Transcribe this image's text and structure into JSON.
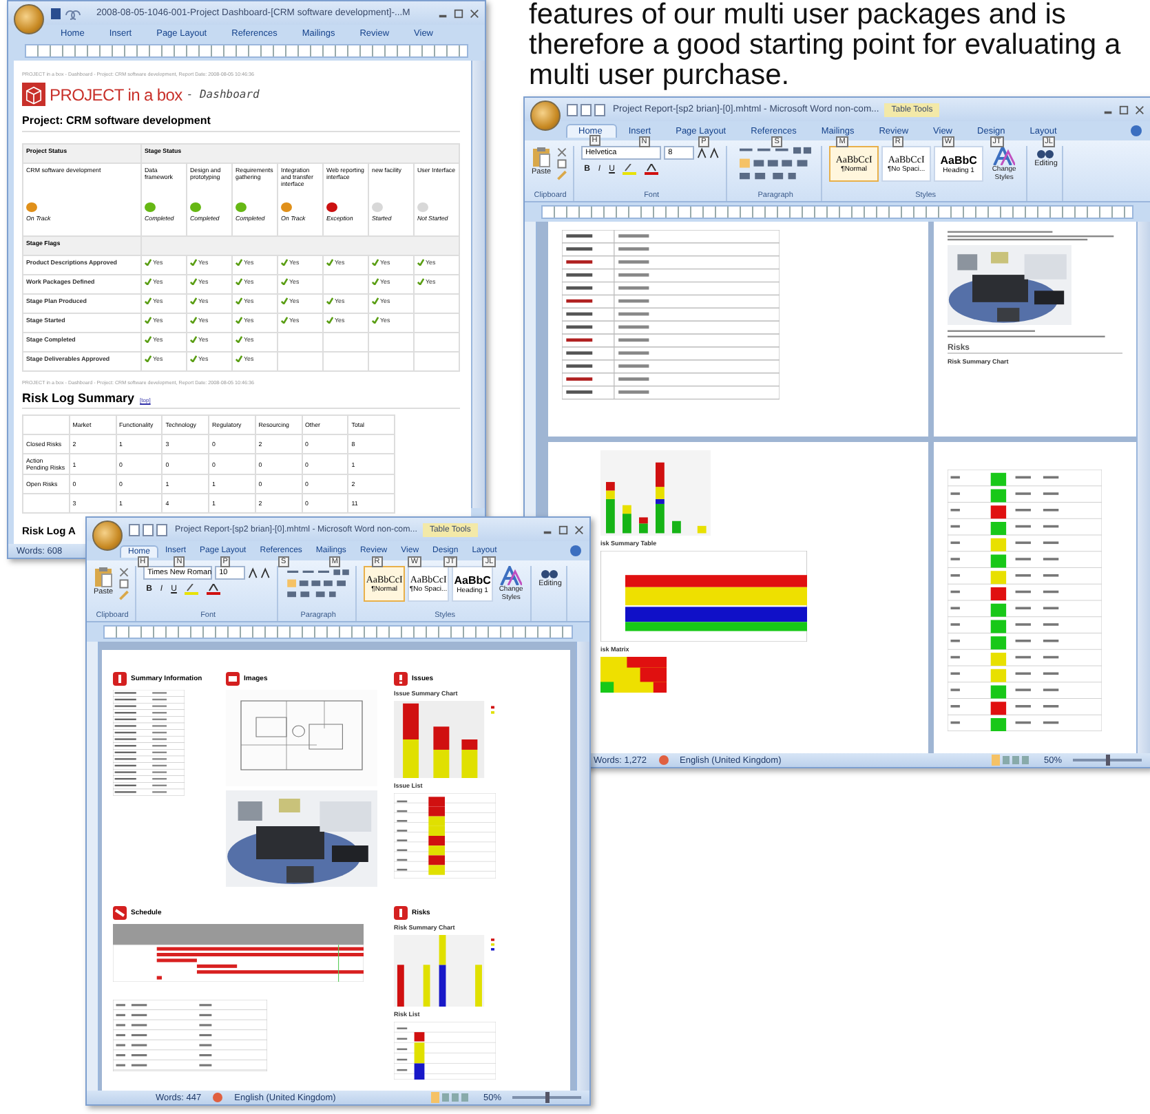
{
  "intro": {
    "text": "features of our multi user packages and is therefore a good starting point for evaluating a multi user purchase."
  },
  "dashboard_window": {
    "title": "2008-08-05-1046-001-Project Dashboard-[CRM software development]-...M",
    "tabs": [
      {
        "label": "Home",
        "selected": false
      },
      {
        "label": "Insert",
        "selected": false
      },
      {
        "label": "Page Layout",
        "selected": false
      },
      {
        "label": "References",
        "selected": false
      },
      {
        "label": "Mailings",
        "selected": false
      },
      {
        "label": "Review",
        "selected": false
      },
      {
        "label": "View",
        "selected": false
      }
    ],
    "breadcrumb": "PROJECT in a box - Dashboard - Project: CRM software development, Report Date: 2008-08-05 10:46:36",
    "logo_text": "PROJECT in a box",
    "logo_suffix": "- Dashboard",
    "project_heading": "Project: CRM software development",
    "status_table": {
      "project_header": "Project Status",
      "stage_header": "Stage Status",
      "project": {
        "name": "CRM software development",
        "status": "On Track",
        "color": "#e0901a"
      },
      "stages": [
        {
          "name": "Data framework",
          "status": "Completed",
          "color": "#66b814"
        },
        {
          "name": "Design and prototyping",
          "status": "Completed",
          "color": "#66b814"
        },
        {
          "name": "Requirements gathering",
          "status": "Completed",
          "color": "#66b814"
        },
        {
          "name": "Integration and transfer interface",
          "status": "On Track",
          "color": "#e0901a"
        },
        {
          "name": "Web reporting interface",
          "status": "Exception",
          "color": "#cc1111"
        },
        {
          "name": "new facility",
          "status": "Started",
          "color": "#d8d8d8"
        },
        {
          "name": "User Interface",
          "status": "Not Started",
          "color": "#d8d8d8"
        }
      ],
      "flags_header": "Stage Flags",
      "flags": [
        {
          "name": "Product Descriptions Approved",
          "values": [
            {
              "done": true,
              "text": "Yes"
            },
            {
              "done": true,
              "text": "Yes"
            },
            {
              "done": true,
              "text": "Yes"
            },
            {
              "done": true,
              "text": "Yes"
            },
            {
              "done": true,
              "text": "Yes"
            },
            {
              "done": true,
              "text": "Yes"
            },
            {
              "done": true,
              "text": "Yes"
            }
          ]
        },
        {
          "name": "Work Packages Defined",
          "values": [
            {
              "done": true,
              "text": "Yes"
            },
            {
              "done": true,
              "text": "Yes"
            },
            {
              "done": true,
              "text": "Yes"
            },
            {
              "done": true,
              "text": "Yes"
            },
            {
              "done": false
            },
            {
              "done": true,
              "text": "Yes"
            },
            {
              "done": true,
              "text": "Yes"
            }
          ]
        },
        {
          "name": "Stage Plan Produced",
          "values": [
            {
              "done": true,
              "text": "Yes"
            },
            {
              "done": true,
              "text": "Yes"
            },
            {
              "done": true,
              "text": "Yes"
            },
            {
              "done": true,
              "text": "Yes"
            },
            {
              "done": true,
              "text": "Yes"
            },
            {
              "done": true,
              "text": "Yes"
            },
            {
              "done": false
            }
          ]
        },
        {
          "name": "Stage Started",
          "values": [
            {
              "done": true,
              "text": "Yes"
            },
            {
              "done": true,
              "text": "Yes"
            },
            {
              "done": true,
              "text": "Yes"
            },
            {
              "done": true,
              "text": "Yes"
            },
            {
              "done": true,
              "text": "Yes"
            },
            {
              "done": true,
              "text": "Yes"
            },
            {
              "done": false
            }
          ]
        },
        {
          "name": "Stage Completed",
          "values": [
            {
              "done": true,
              "text": "Yes"
            },
            {
              "done": true,
              "text": "Yes"
            },
            {
              "done": true,
              "text": "Yes"
            },
            {
              "done": false
            },
            {
              "done": false
            },
            {
              "done": false
            },
            {
              "done": false
            }
          ]
        },
        {
          "name": "Stage Deliverables Approved",
          "values": [
            {
              "done": true,
              "text": "Yes"
            },
            {
              "done": true,
              "text": "Yes"
            },
            {
              "done": true,
              "text": "Yes"
            },
            {
              "done": false
            },
            {
              "done": false
            },
            {
              "done": false
            },
            {
              "done": false
            }
          ]
        }
      ]
    },
    "breadcrumb_2": "PROJECT in a box - Dashboard - Project: CRM software development, Report Date: 2008-08-05 10:46:36",
    "risk_heading": "Risk Log Summary",
    "top_link": "[top]",
    "risk_table": {
      "columns": [
        "Market",
        "Functionality",
        "Technology",
        "Regulatory",
        "Resourcing",
        "Other",
        "Total"
      ],
      "rows": [
        {
          "label": "Closed Risks",
          "cells": [
            "2",
            "1",
            "3",
            "0",
            "2",
            "0",
            "8"
          ]
        },
        {
          "label": "Action Pending Risks",
          "cells": [
            "1",
            "0",
            "0",
            "0",
            "0",
            "0",
            "1"
          ]
        },
        {
          "label": "Open Risks",
          "cells": [
            "0",
            "0",
            "1",
            "1",
            "0",
            "0",
            "2"
          ]
        },
        {
          "cells": [
            "3",
            "1",
            "4",
            "1",
            "2",
            "0",
            "11"
          ]
        }
      ]
    },
    "next_heading": "Risk Log A",
    "status": {
      "words": "Words: 608"
    }
  },
  "report_windows": [
    {
      "title": "Project Report-[sp2 brian]-[0].mhtml - Microsoft Word non-com...",
      "context_tab": "Table Tools",
      "tabs": [
        {
          "label": "Home",
          "keytip": "H",
          "selected": true
        },
        {
          "label": "Insert",
          "keytip": "N",
          "selected": false
        },
        {
          "label": "Page Layout",
          "keytip": "P",
          "selected": false
        },
        {
          "label": "References",
          "keytip": "S",
          "selected": false
        },
        {
          "label": "Mailings",
          "keytip": "M",
          "selected": false
        },
        {
          "label": "Review",
          "keytip": "R",
          "selected": false
        },
        {
          "label": "View",
          "keytip": "W",
          "selected": false
        },
        {
          "label": "Design",
          "keytip": "JT",
          "selected": false
        },
        {
          "label": "Layout",
          "keytip": "JL",
          "selected": false
        }
      ],
      "paste_label": "Paste",
      "font_name": "Helvetica",
      "font_size": "8",
      "format_buttons": [
        "B",
        "I",
        "U"
      ],
      "styles": [
        {
          "sample": "AaBbCcI",
          "name": "¶Normal",
          "kind": "body",
          "selected": true
        },
        {
          "sample": "AaBbCcI",
          "name": "¶No Spaci...",
          "kind": "body",
          "selected": false
        },
        {
          "sample": "AaBbC",
          "name": "Heading 1",
          "kind": "heading",
          "selected": false
        }
      ],
      "change_styles": "Change Styles",
      "editing": "Editing",
      "group_labels": [
        "Clipboard",
        "Font",
        "Paragraph",
        "Styles"
      ],
      "document": {
        "risks_heading": "Risks",
        "risk_chart_label": "Risk Summary Chart",
        "risk_table_label": "isk Summary Table",
        "risk_matrix_label": "isk Matrix"
      },
      "status": {
        "words": "Words: 1,272",
        "language": "English (United Kingdom)",
        "zoom": "50%",
        "zoom_slider": {
          "level": 0.5
        }
      }
    },
    {
      "title": "Project Report-[sp2 brian]-[0].mhtml - Microsoft Word non-com...",
      "context_tab": "Table Tools",
      "tabs": [
        {
          "label": "Home",
          "keytip": "H",
          "selected": true
        },
        {
          "label": "Insert",
          "keytip": "N",
          "selected": false
        },
        {
          "label": "Page Layout",
          "keytip": "P",
          "selected": false
        },
        {
          "label": "References",
          "keytip": "S",
          "selected": false
        },
        {
          "label": "Mailings",
          "keytip": "M",
          "selected": false
        },
        {
          "label": "Review",
          "keytip": "R",
          "selected": false
        },
        {
          "label": "View",
          "keytip": "W",
          "selected": false
        },
        {
          "label": "Design",
          "keytip": "JT",
          "selected": false
        },
        {
          "label": "Layout",
          "keytip": "JL",
          "selected": false
        }
      ],
      "paste_label": "Paste",
      "font_name": "Times New Roman",
      "font_size": "10",
      "format_buttons": [
        "B",
        "I",
        "U"
      ],
      "styles": [
        {
          "sample": "AaBbCcI",
          "name": "¶Normal",
          "kind": "body",
          "selected": true
        },
        {
          "sample": "AaBbCcI",
          "name": "¶No Spaci...",
          "kind": "body",
          "selected": false
        },
        {
          "sample": "AaBbC",
          "name": "Heading 1",
          "kind": "heading",
          "selected": false
        }
      ],
      "change_styles": "Change Styles",
      "editing": "Editing",
      "group_labels": [
        "Clipboard",
        "Font",
        "Paragraph",
        "Styles"
      ],
      "document": {
        "sections": [
          {
            "title": "Summary Information"
          },
          {
            "title": "Images"
          },
          {
            "title": "Issues"
          },
          {
            "title": "Schedule"
          },
          {
            "title": "Risks"
          }
        ],
        "issue_chart_label": "Issue Summary Chart",
        "issue_list_label": "Issue List",
        "risk_chart_label": "Risk Summary Chart",
        "risk_list_label": "Risk List"
      },
      "status": {
        "words": "Words: 447",
        "language": "English (United Kingdom)",
        "zoom": "50%",
        "zoom_slider": {
          "level": 0.5
        }
      }
    }
  ]
}
